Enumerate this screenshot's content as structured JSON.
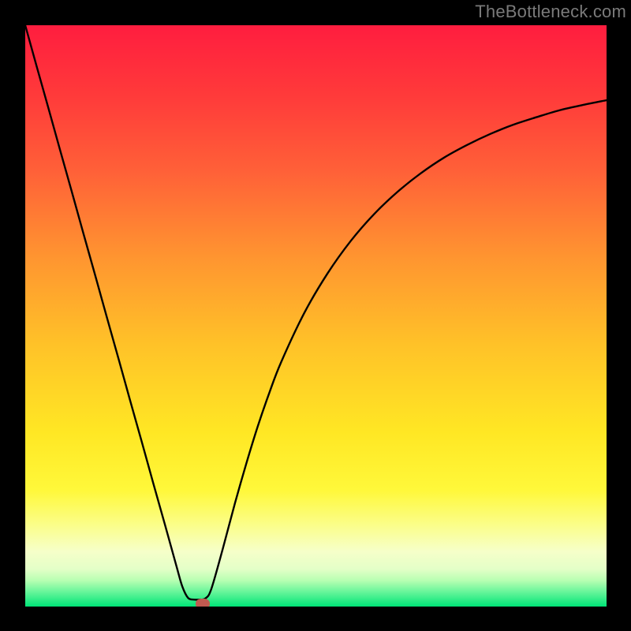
{
  "watermark": {
    "text": "TheBottleneck.com"
  },
  "chart_data": {
    "type": "line",
    "title": "",
    "xlabel": "",
    "ylabel": "",
    "x_range": [
      0,
      100
    ],
    "y_range": [
      0,
      100
    ],
    "series": [
      {
        "name": "bottleneck-curve",
        "x": [
          0,
          2,
          4,
          6,
          8,
          10,
          12,
          14,
          16,
          18,
          20,
          22,
          24,
          26,
          27,
          28,
          29,
          30,
          31,
          32,
          34,
          36,
          38,
          40,
          42,
          44,
          48,
          52,
          56,
          60,
          64,
          68,
          72,
          76,
          80,
          84,
          88,
          92,
          96,
          100
        ],
        "y": [
          100,
          92.8,
          85.7,
          78.5,
          71.4,
          64.2,
          57.1,
          49.9,
          42.8,
          35.6,
          28.5,
          21.3,
          14.2,
          7.0,
          3.5,
          1.5,
          1.2,
          1.2,
          1.4,
          3.0,
          10.0,
          17.5,
          24.5,
          31.0,
          36.8,
          42.0,
          50.5,
          57.3,
          62.9,
          67.5,
          71.3,
          74.5,
          77.2,
          79.4,
          81.3,
          82.9,
          84.2,
          85.4,
          86.3,
          87.1
        ]
      }
    ],
    "marker": {
      "x": 30.5,
      "y": 0.6
    },
    "gradient_stops": [
      {
        "offset": 0.0,
        "color": "#ff1d3f"
      },
      {
        "offset": 0.12,
        "color": "#ff3a3a"
      },
      {
        "offset": 0.25,
        "color": "#ff6038"
      },
      {
        "offset": 0.4,
        "color": "#ff9530"
      },
      {
        "offset": 0.55,
        "color": "#ffc228"
      },
      {
        "offset": 0.7,
        "color": "#ffe724"
      },
      {
        "offset": 0.8,
        "color": "#fff83a"
      },
      {
        "offset": 0.86,
        "color": "#fbfe8a"
      },
      {
        "offset": 0.905,
        "color": "#f6ffc9"
      },
      {
        "offset": 0.935,
        "color": "#e4ffc8"
      },
      {
        "offset": 0.955,
        "color": "#b8ffb2"
      },
      {
        "offset": 0.975,
        "color": "#66f59a"
      },
      {
        "offset": 1.0,
        "color": "#00e577"
      }
    ]
  }
}
